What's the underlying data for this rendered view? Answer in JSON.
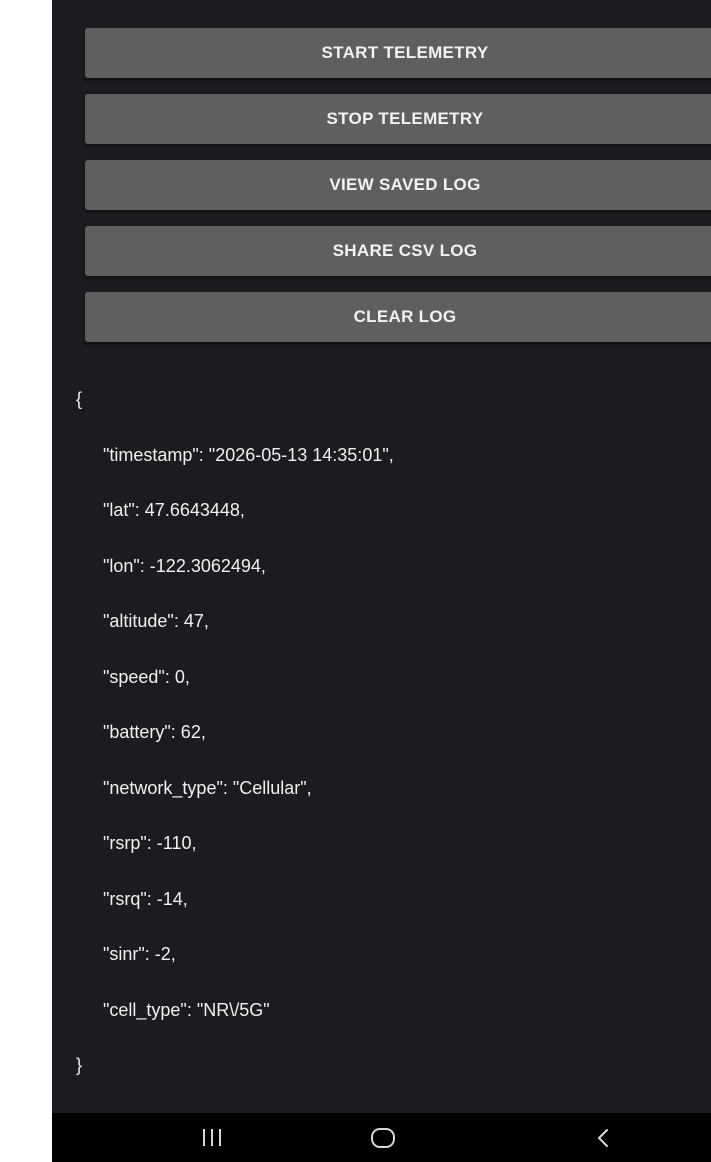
{
  "buttons": [
    {
      "label": "START TELEMETRY"
    },
    {
      "label": "STOP TELEMETRY"
    },
    {
      "label": "VIEW SAVED LOG"
    },
    {
      "label": "SHARE CSV LOG"
    },
    {
      "label": "CLEAR LOG"
    }
  ],
  "log": {
    "open_brace": "{",
    "lines": [
      "\"timestamp\": \"2026-05-13 14:35:01\",",
      "\"lat\": 47.6643448,",
      "\"lon\": -122.3062494,",
      "\"altitude\": 47,",
      "\"speed\": 0,",
      "\"battery\": 62,",
      "\"network_type\": \"Cellular\",",
      "\"rsrp\": -110,",
      "\"rsrq\": -14,",
      "\"sinr\": -2,",
      "\"cell_type\": \"NR\\/5G\""
    ],
    "close_brace": "}"
  },
  "nav": {
    "recents_icon": "recents-icon",
    "home_icon": "home-icon",
    "back_icon": "back-icon",
    "back_glyph": "<"
  },
  "colors": {
    "background": "#1c1b1f",
    "button": "#5f5f5f",
    "text": "#f0f0f0",
    "nav_bar": "#000000"
  }
}
